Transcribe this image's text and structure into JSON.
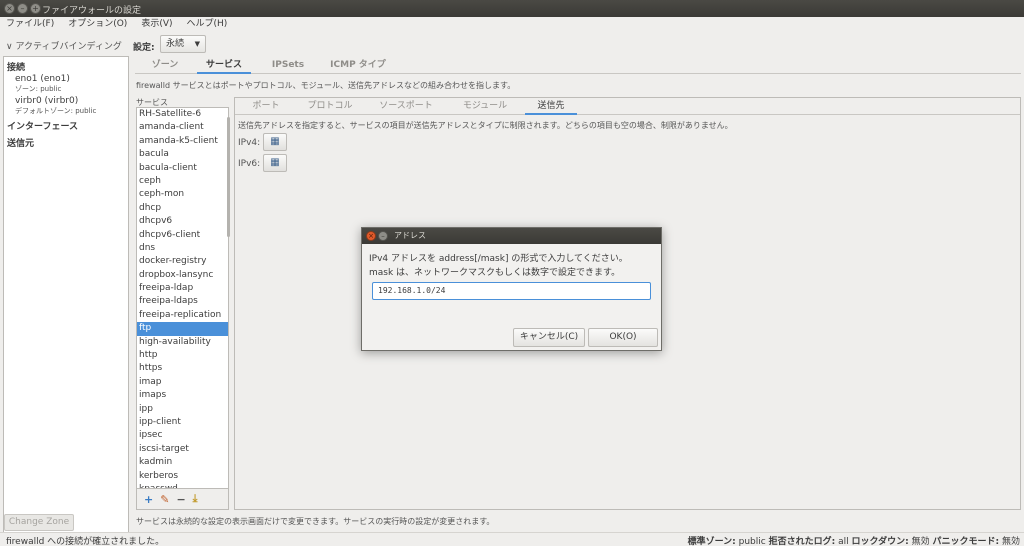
{
  "window": {
    "title": "ファイアウォールの設定"
  },
  "menu": [
    "ファイル(F)",
    "オプション(O)",
    "表示(V)",
    "ヘルプ(H)"
  ],
  "left_panel": {
    "header": "アクティブバインディング",
    "connections_label": "接続",
    "connections": [
      {
        "name": "eno1 (eno1)",
        "zone": "ゾーン: public"
      },
      {
        "name": "virbr0 (virbr0)",
        "zone": "デフォルトゾーン: public"
      }
    ],
    "interfaces_label": "インターフェース",
    "sources_label": "送信元",
    "change_zone": "Change Zone"
  },
  "settings": {
    "label": "設定:",
    "value": "永続"
  },
  "main_tabs": [
    "ゾーン",
    "サービス",
    "IPSets",
    "ICMP タイプ"
  ],
  "active_main_tab": "サービス",
  "services_description": "firewalld サービスとはポートやプロトコル、モジュール、送信先アドレスなどの組み合わせを指します。",
  "services_label": "サービス",
  "services": [
    "RH-Satellite-6",
    "amanda-client",
    "amanda-k5-client",
    "bacula",
    "bacula-client",
    "ceph",
    "ceph-mon",
    "dhcp",
    "dhcpv6",
    "dhcpv6-client",
    "dns",
    "docker-registry",
    "dropbox-lansync",
    "freeipa-ldap",
    "freeipa-ldaps",
    "freeipa-replication",
    "ftp",
    "high-availability",
    "http",
    "https",
    "imap",
    "imaps",
    "ipp",
    "ipp-client",
    "ipsec",
    "iscsi-target",
    "kadmin",
    "kerberos",
    "kpasswd"
  ],
  "selected_service": "ftp",
  "list_toolbar": {
    "add": "+",
    "edit": "✎",
    "remove": "−",
    "load": "⤓"
  },
  "sub_tabs": [
    "ポート",
    "プロトコル",
    "ソースポート",
    "モジュール",
    "送信先"
  ],
  "active_sub_tab": "送信先",
  "destination": {
    "description": "送信先アドレスを指定すると、サービスの項目が送信先アドレスとタイプに制限されます。どちらの項目も空の場合、制限がありません。",
    "ipv4_label": "IPv4:",
    "ipv6_label": "IPv6:"
  },
  "footnote": "サービスは永続的な設定の表示画面だけで変更できます。サービスの実行時の設定が変更されます。",
  "status": {
    "left": "firewalld への接続が確立されました。",
    "default_zone_label": "標準ゾーン:",
    "default_zone": "public",
    "denied_log_label": "拒否されたログ:",
    "denied_log": "all",
    "lockdown_label": "ロックダウン:",
    "lockdown": "無効",
    "panic_label": "パニックモード:",
    "panic": "無効"
  },
  "dialog": {
    "title": "アドレス",
    "message1": "IPv4 アドレスを address[/mask] の形式で入力してください。",
    "message2": "mask は、ネットワークマスクもしくは数字で設定できます。",
    "value": "192.168.1.0/24",
    "cancel": "キャンセル(C)",
    "ok": "OK(O)"
  },
  "colors": {
    "accent": "#4a90d9",
    "titlebar": "#3b3a36",
    "close": "#e15a2b"
  }
}
